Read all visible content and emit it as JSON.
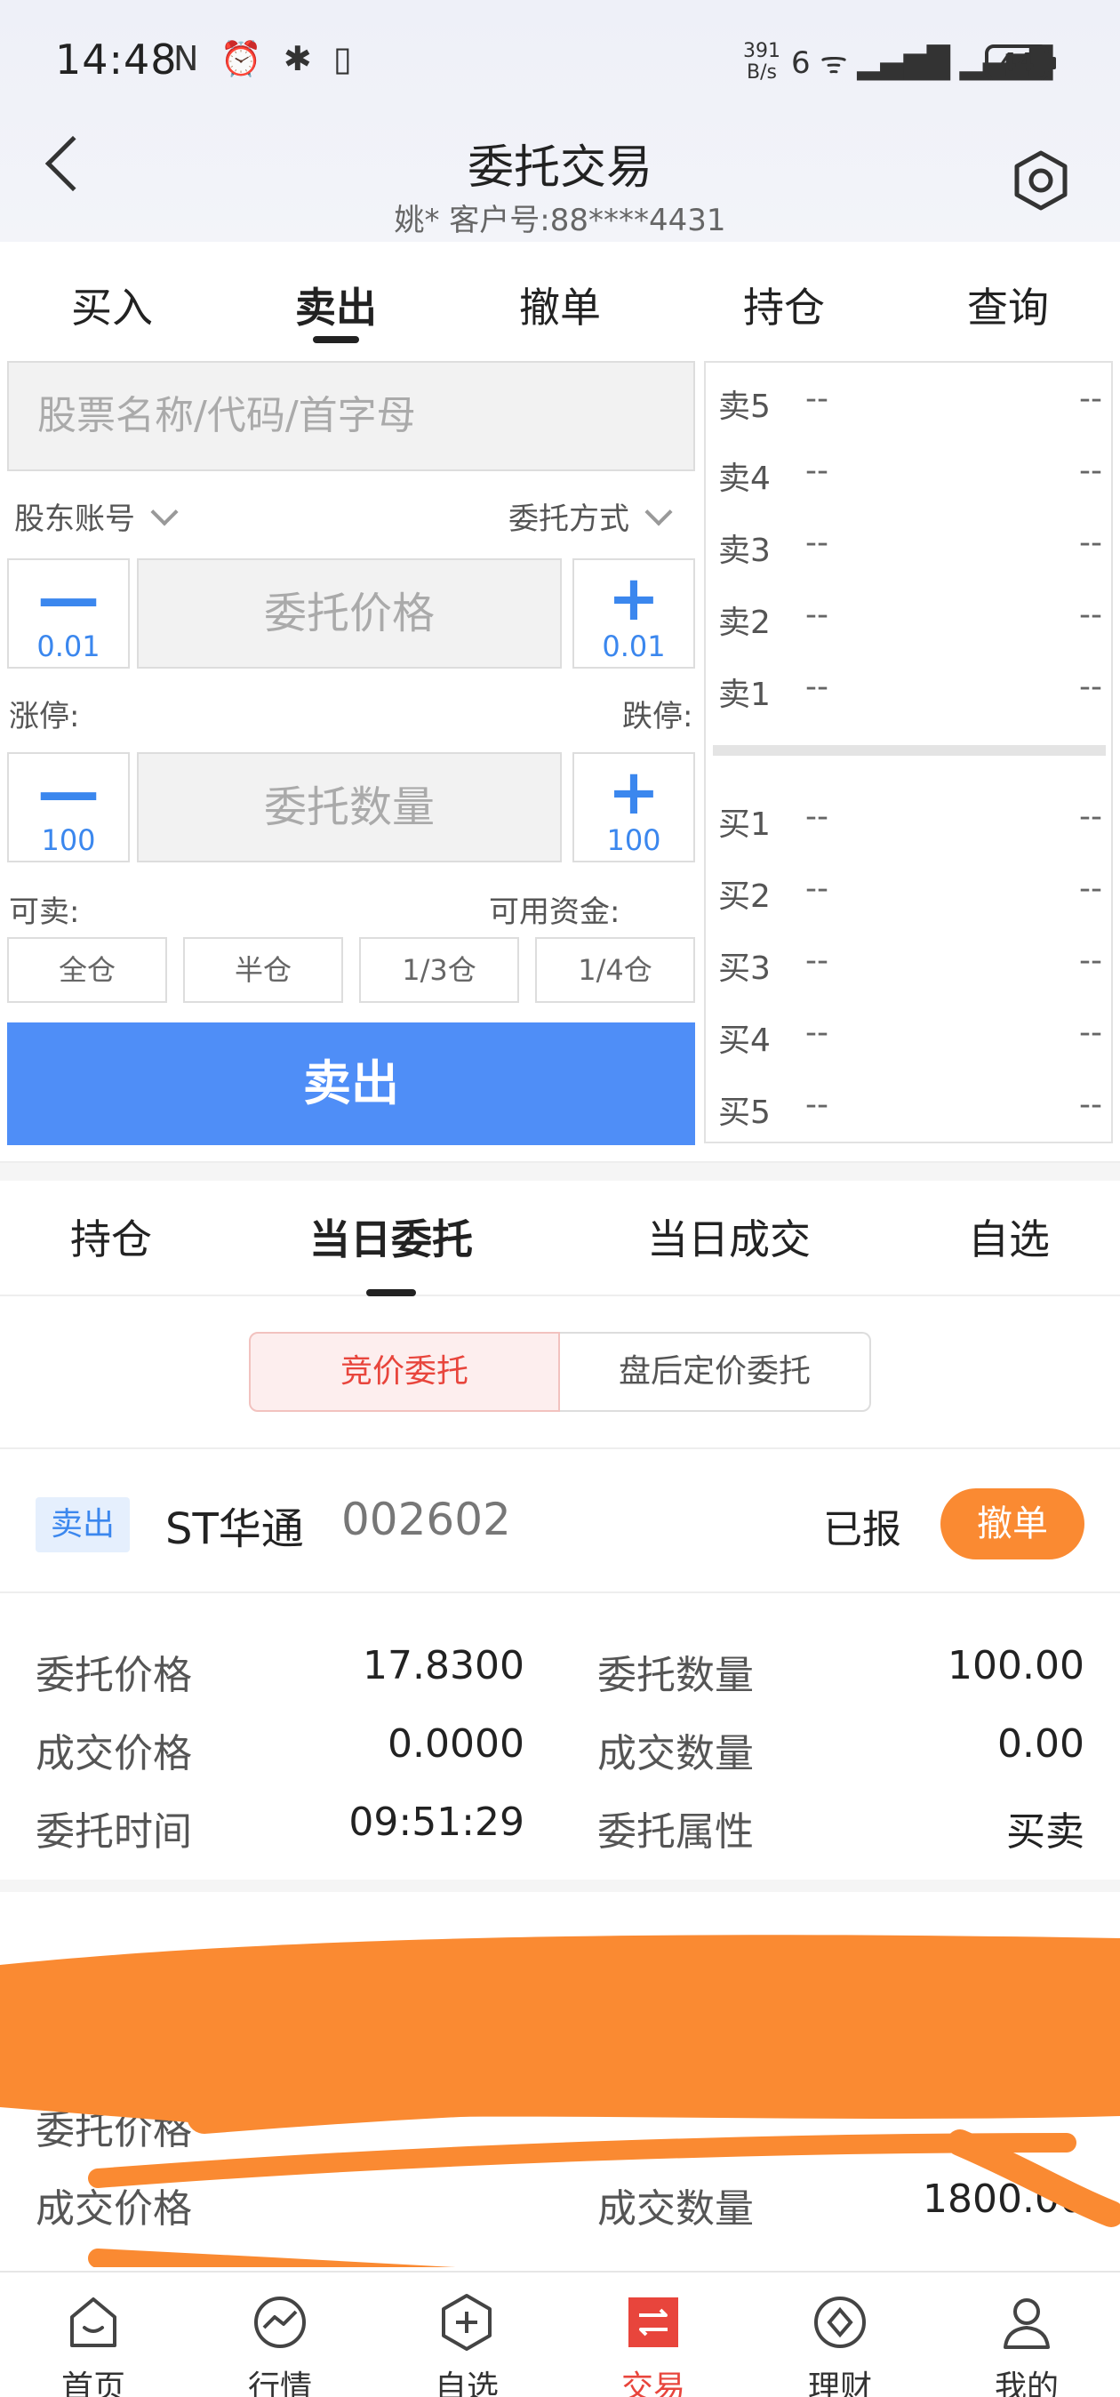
{
  "status_bar": {
    "time": "14:48",
    "left_icons": "N ⏰ ✱ ▯",
    "net_speed_top": "391",
    "net_speed_bottom": "B/s",
    "signal": "6 ᯤ ▂▄▆█ ▂▄▆█",
    "battery": "44"
  },
  "header": {
    "title": "委托交易",
    "subtitle": "姚* 客户号:88****4431"
  },
  "tabs": [
    {
      "label": "买入"
    },
    {
      "label": "卖出"
    },
    {
      "label": "撤单"
    },
    {
      "label": "持仓"
    },
    {
      "label": "查询"
    }
  ],
  "form": {
    "search_placeholder": "股票名称/代码/首字母",
    "account_label": "股东账号",
    "order_type_label": "委托方式",
    "price_placeholder": "委托价格",
    "price_step": "0.01",
    "limit_up_label": "涨停:",
    "limit_down_label": "跌停:",
    "qty_placeholder": "委托数量",
    "qty_step": "100",
    "sellable_label": "可卖:",
    "funds_label": "可用资金:",
    "ratios": [
      "全仓",
      "半仓",
      "1/3仓",
      "1/4仓"
    ],
    "sell_button": "卖出"
  },
  "order_book": {
    "asks": [
      {
        "label": "卖5",
        "price": "--",
        "vol": "--"
      },
      {
        "label": "卖4",
        "price": "--",
        "vol": "--"
      },
      {
        "label": "卖3",
        "price": "--",
        "vol": "--"
      },
      {
        "label": "卖2",
        "price": "--",
        "vol": "--"
      },
      {
        "label": "卖1",
        "price": "--",
        "vol": "--"
      }
    ],
    "bids": [
      {
        "label": "买1",
        "price": "--",
        "vol": "--"
      },
      {
        "label": "买2",
        "price": "--",
        "vol": "--"
      },
      {
        "label": "买3",
        "price": "--",
        "vol": "--"
      },
      {
        "label": "买4",
        "price": "--",
        "vol": "--"
      },
      {
        "label": "买5",
        "price": "--",
        "vol": "--"
      }
    ]
  },
  "subtabs": [
    {
      "label": "持仓"
    },
    {
      "label": "当日委托"
    },
    {
      "label": "当日成交"
    },
    {
      "label": "自选"
    }
  ],
  "segments": {
    "on": "竞价委托",
    "off": "盘后定价委托"
  },
  "order": {
    "side": "卖出",
    "name": "ST华通",
    "code": "002602",
    "status": "已报",
    "cancel": "撤单",
    "fields": [
      {
        "k1": "委托价格",
        "v1": "17.8300",
        "k2": "委托数量",
        "v2": "100.00"
      },
      {
        "k1": "成交价格",
        "v1": "0.0000",
        "k2": "成交数量",
        "v2": "0.00"
      },
      {
        "k1": "委托时间",
        "v1": "09:51:29",
        "k2": "委托属性",
        "v2": "买卖"
      }
    ]
  },
  "order2": {
    "k1": "委托价格",
    "k2": "成交价格",
    "k3": "成交数量",
    "v_qty": "1800.00"
  },
  "colors": {
    "accent": "#4f8ef7",
    "orange": "#fa8a32",
    "red": "#e8453c"
  },
  "bottom_nav": [
    {
      "label": "首页",
      "icon": "home-icon"
    },
    {
      "label": "行情",
      "icon": "chart-icon"
    },
    {
      "label": "自选",
      "icon": "watchlist-icon"
    },
    {
      "label": "交易",
      "icon": "trade-icon"
    },
    {
      "label": "理财",
      "icon": "finance-icon"
    },
    {
      "label": "我的",
      "icon": "profile-icon"
    }
  ]
}
